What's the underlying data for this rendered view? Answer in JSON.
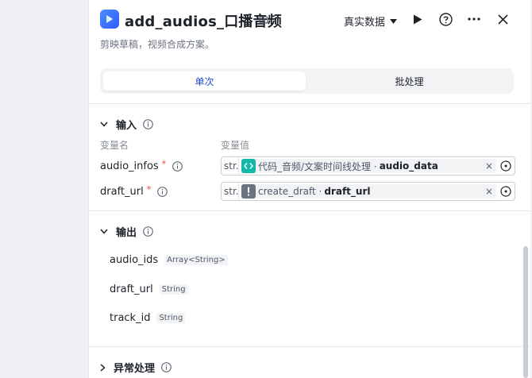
{
  "header": {
    "title": "add_audios_口播音频",
    "subtitle": "剪映草稿，视频合成方案。",
    "data_select": "真实数据"
  },
  "tabs": [
    {
      "label": "单次",
      "active": true
    },
    {
      "label": "批处理",
      "active": false
    }
  ],
  "input": {
    "section_label": "输入",
    "col_name": "变量名",
    "col_value": "变量值",
    "params": [
      {
        "name": "audio_infos",
        "required": "*",
        "type": "str.",
        "source": "代码_音频/文案时间线处理 ·",
        "var": "audio_data",
        "icon": "code-icon",
        "icon_color": "#15b8a6"
      },
      {
        "name": "draft_url",
        "required": "*",
        "type": "str.",
        "source": "create_draft ·",
        "var": "draft_url",
        "icon": "exclamation-icon",
        "icon_color": "#6b7280"
      }
    ]
  },
  "output": {
    "section_label": "输出",
    "items": [
      {
        "name": "audio_ids",
        "type": "Array<String>"
      },
      {
        "name": "draft_url",
        "type": "String"
      },
      {
        "name": "track_id",
        "type": "String"
      }
    ]
  },
  "exception": {
    "section_label": "异常处理"
  },
  "colors": {
    "accent": "#1e4fd8",
    "required": "#f53f3f",
    "code_tag": "#15b8a6"
  }
}
